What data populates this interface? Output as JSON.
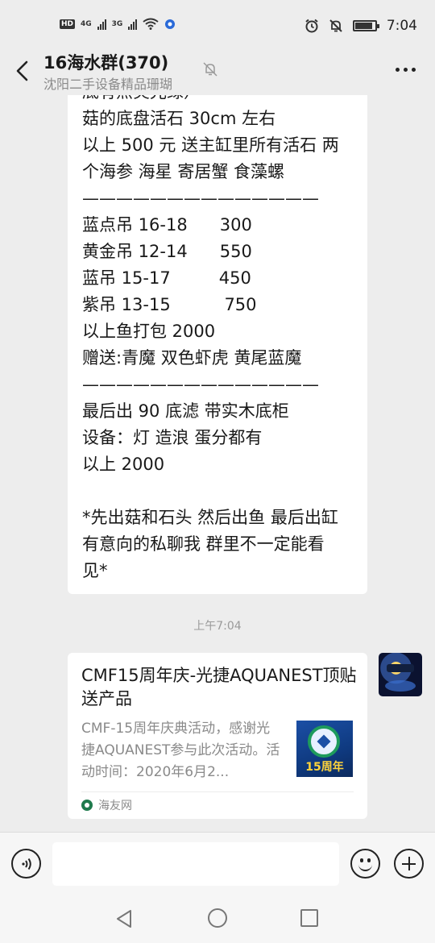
{
  "status_bar": {
    "hd_tag": "HD",
    "sim1": "4G",
    "sim2": "3G",
    "time": "7:04"
  },
  "header": {
    "title": "16海水群(370)",
    "subtitle": "沈阳二手设备精品珊瑚"
  },
  "messages": {
    "text_message_lines": [
      "底有点炎光绿）",
      "菇的底盘活石 30cm 左右",
      "以上 500 元 送主缸里所有活石 两",
      "个海参 海星 寄居蟹 食藻螺",
      "——————————————",
      "蓝点吊 16-18      300",
      "黄金吊 12-14      550",
      "蓝吊 15-17         450",
      "紫吊 13-15          750",
      "以上鱼打包 2000",
      "赠送:青魔 双色虾虎 黄尾蓝魔",
      "——————————————",
      "最后出 90 底滤 带实木底柜",
      "设备：灯 造浪 蛋分都有",
      "以上 2000",
      "",
      "*先出菇和石头 然后出鱼 最后出缸",
      "有意向的私聊我 群里不一定能看",
      "见*"
    ],
    "timestamp": "上午7:04",
    "link_card": {
      "title": "CMF15周年庆-光捷AQUANEST顶贴送产品",
      "description": "CMF-15周年庆典活动，感谢光捷AQUANEST参与此次活动。活动时间：2020年6月2...",
      "thumbnail_text": "15周年",
      "source": "海友网"
    }
  },
  "input_bar": {
    "text_value": "",
    "placeholder": ""
  },
  "colors": {
    "background": "#ededed",
    "bubble": "#ffffff",
    "muted_text": "#8a8a8a"
  }
}
